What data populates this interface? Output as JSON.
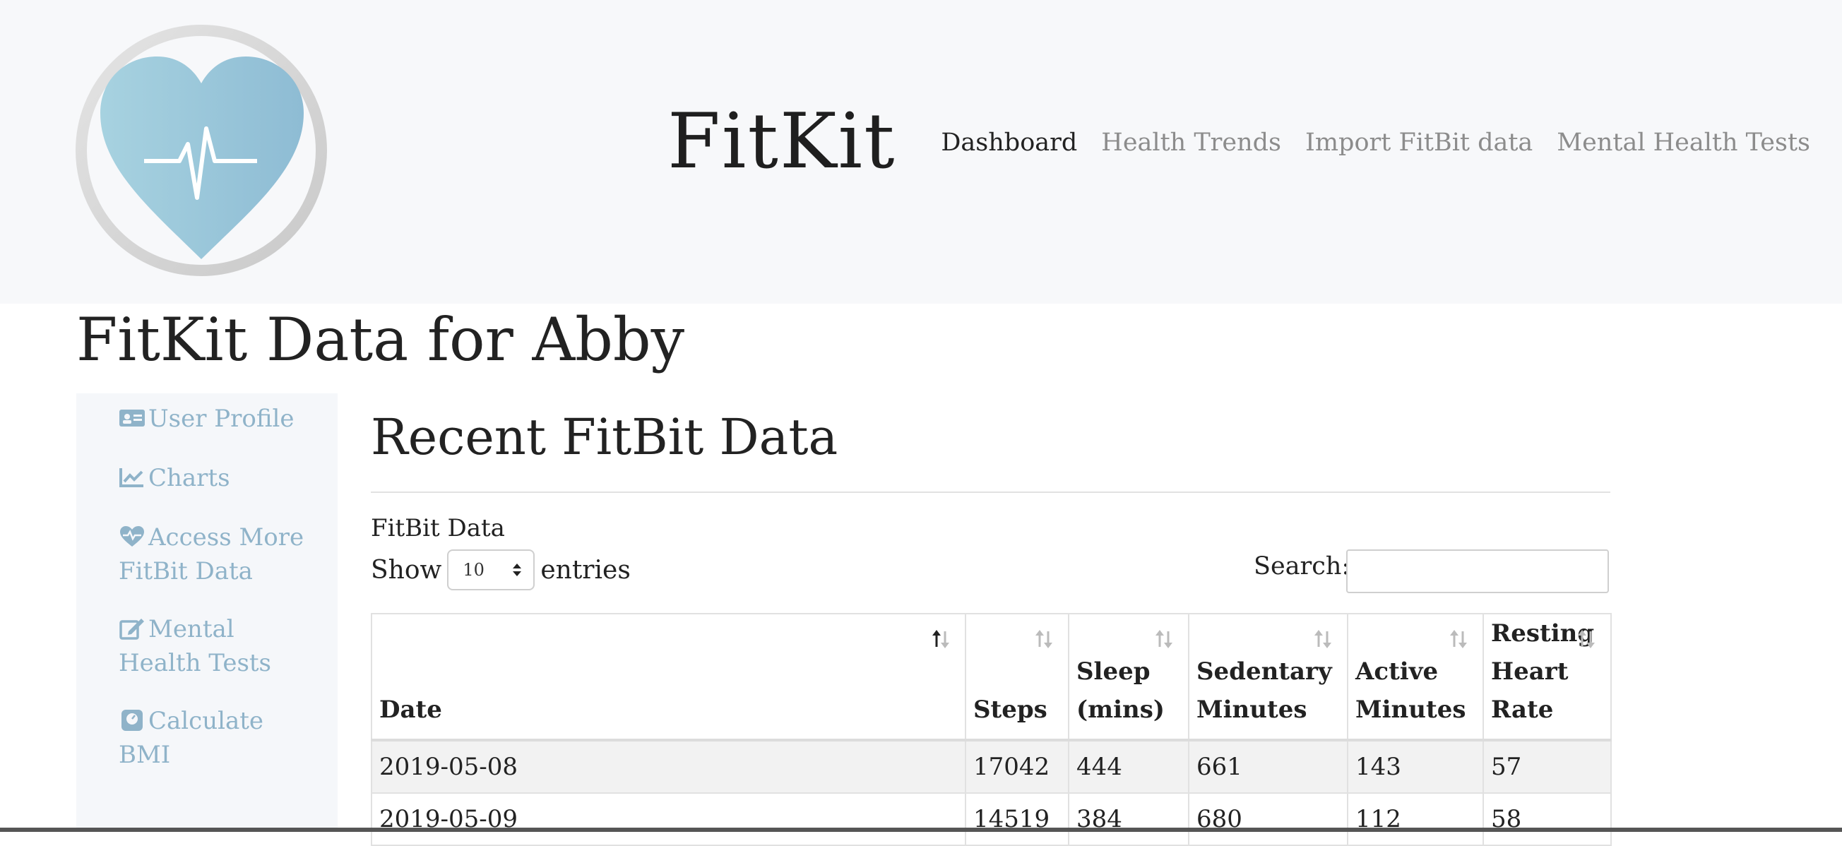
{
  "header": {
    "brand": "FitKit",
    "nav": [
      "Dashboard",
      "Health Trends",
      "Import FitBit data",
      "Mental Health Tests"
    ]
  },
  "page_title": "FitKit Data for Abby",
  "sidebar": {
    "items": [
      {
        "label": "User Profile",
        "icon": "id-card-icon"
      },
      {
        "label": "Charts",
        "icon": "line-chart-icon"
      },
      {
        "label": "Access More FitBit Data",
        "icon": "heartbeat-icon"
      },
      {
        "label": "Mental Health Tests",
        "icon": "edit-icon"
      },
      {
        "label": "Calculate BMI",
        "icon": "scale-icon"
      }
    ]
  },
  "main": {
    "section_title": "Recent FitBit Data",
    "caption": "FitBit Data",
    "show_label": "Show",
    "entries_value": "10",
    "entries_label": "entries",
    "search_label": "Search:",
    "search_value": ""
  },
  "table": {
    "columns": [
      "Date",
      "Steps",
      "Sleep (mins)",
      "Sedentary Minutes",
      "Active Minutes",
      "Resting Heart Rate"
    ],
    "rows": [
      [
        "2019-05-08",
        "17042",
        "444",
        "661",
        "143",
        "57"
      ],
      [
        "2019-05-09",
        "14519",
        "384",
        "680",
        "112",
        "58"
      ]
    ]
  },
  "colors": {
    "header_bg": "#f7f8fa",
    "sidebar_link": "#8fb3c9",
    "nav_inactive": "#8c8c8c",
    "heart": "#9cc6d8"
  }
}
